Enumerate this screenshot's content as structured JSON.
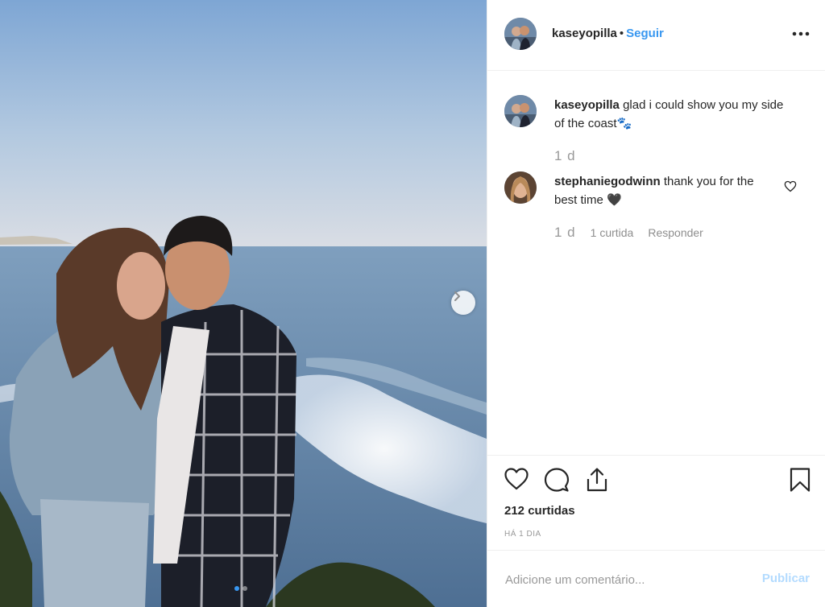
{
  "post": {
    "author": "kaseyopilla",
    "separator": "•",
    "follow_label": "Seguir",
    "more_icon": "more-options-icon"
  },
  "comments": [
    {
      "username": "kaseyopilla",
      "text": "glad i could show you my side of the coast",
      "emoji": "🐾",
      "age": "1 d"
    },
    {
      "username": "stephaniegodwinn",
      "text": "thank you for the best time",
      "emoji": "🖤",
      "age": "1 d",
      "likes": "1 curtida",
      "reply_label": "Responder"
    }
  ],
  "actions": {
    "likes_count": "212 curtidas",
    "timestamp": "HÁ 1 DIA",
    "icons": [
      "heart-icon",
      "comment-icon",
      "share-icon",
      "bookmark-icon"
    ]
  },
  "add_comment": {
    "placeholder": "Adicione um comentário...",
    "publish_label": "Publicar"
  },
  "carousel": {
    "next_icon": "chevron-right-icon",
    "dots_total": 2,
    "active_dot": 1
  },
  "colors": {
    "accent": "#3897f0",
    "publish_disabled": "#b3dbff",
    "meta_text": "#999999",
    "border": "#efefef"
  }
}
